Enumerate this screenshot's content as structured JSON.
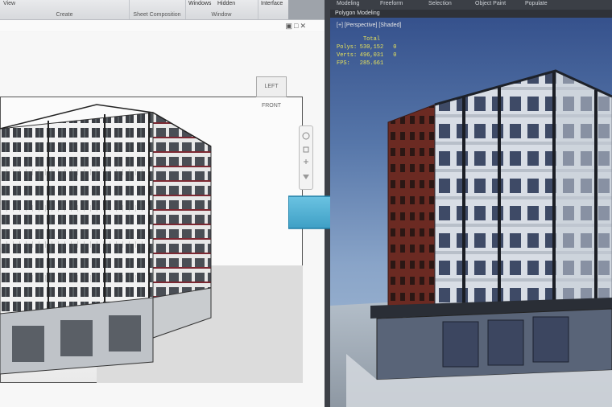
{
  "left_app": {
    "ribbon": {
      "top_left": "View",
      "groups": [
        {
          "label": "Create"
        },
        {
          "label": "Sheet Composition"
        },
        {
          "label": "Window"
        }
      ],
      "buttons": [
        "Windows",
        "Hidden",
        "Interface"
      ]
    },
    "viewcube_label": "LEFT FRONT"
  },
  "right_app": {
    "menu": [
      "Modeling",
      "Freeform",
      "Selection",
      "Object Paint",
      "Populate"
    ],
    "sub_title": "Polygon Modeling",
    "viewport_label": "[+] [Perspective] [Shaded]",
    "stats": {
      "header": "Total",
      "rows": [
        {
          "key": "Polys:",
          "value": "530,152",
          "unit": "0"
        },
        {
          "key": "Verts:",
          "value": "496,031",
          "unit": "0"
        },
        {
          "key": "FPS:",
          "value": "285.661",
          "unit": ""
        }
      ]
    }
  },
  "colors": {
    "arrow": "#35a7d3",
    "sky_top": "#314c88",
    "brick": "#6b2a22",
    "facade": "#d9dde3"
  }
}
